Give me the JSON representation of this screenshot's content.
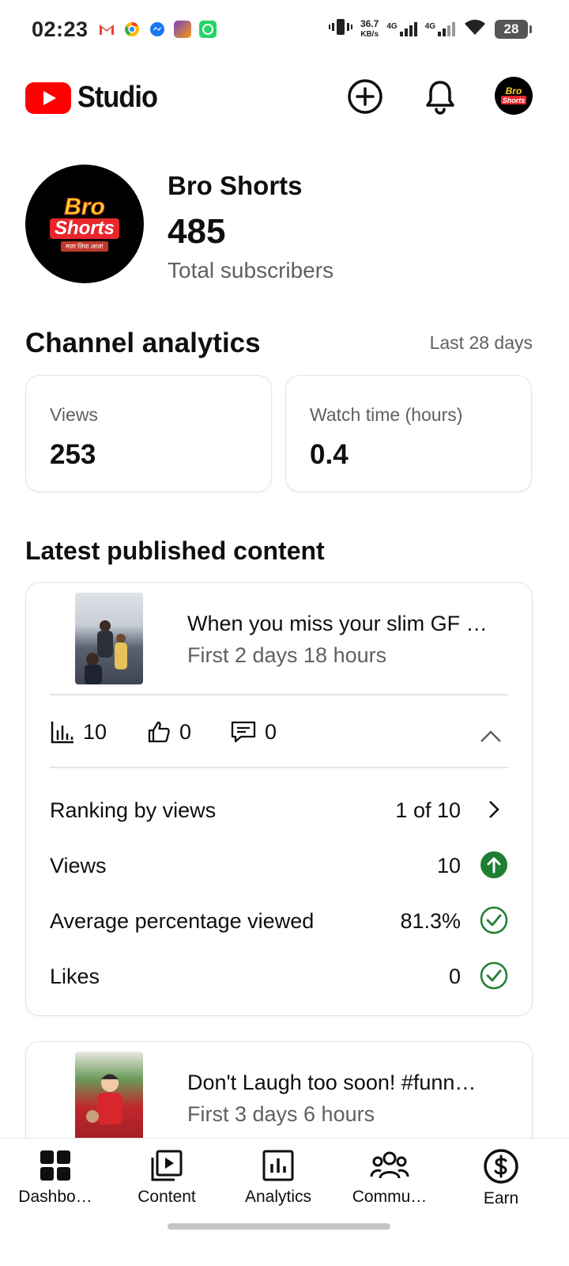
{
  "status_bar": {
    "time": "02:23",
    "net_speed": "36.7",
    "net_speed_unit": "KB/s",
    "signal_1": "4G",
    "signal_2": "4G",
    "battery": "28"
  },
  "app_bar": {
    "logo_text": "Studio",
    "create_icon": "plus-circle-icon",
    "notifications_icon": "bell-icon"
  },
  "channel": {
    "name": "Bro Shorts",
    "subscribers": "485",
    "subscribers_label": "Total subscribers",
    "avatar_text_1": "Bro",
    "avatar_text_2": "Shorts",
    "avatar_tagline": "मज़ा लिया आज!"
  },
  "analytics": {
    "title": "Channel analytics",
    "range": "Last 28 days",
    "cards": [
      {
        "label": "Views",
        "value": "253"
      },
      {
        "label": "Watch time (hours)",
        "value": "0.4"
      }
    ]
  },
  "latest": {
    "title": "Latest published content",
    "items": [
      {
        "title": "When you miss your slim GF …",
        "meta": "First 2 days 18 hours",
        "views": "10",
        "likes": "0",
        "comments": "0",
        "rows": [
          {
            "label": "Ranking by views",
            "value": "1 of 10",
            "icon": "chevron-right-icon"
          },
          {
            "label": "Views",
            "value": "10",
            "icon": "arrow-up-circle-icon"
          },
          {
            "label": "Average percentage viewed",
            "value": "81.3%",
            "icon": "check-circle-icon"
          },
          {
            "label": "Likes",
            "value": "0",
            "icon": "check-circle-icon"
          }
        ]
      },
      {
        "title": "Don't Laugh too soon! #funn…",
        "meta": "First 3 days 6 hours"
      }
    ]
  },
  "colors": {
    "brand_red": "#ff0000",
    "positive_green": "#1e7f34",
    "secondary_text": "#606060"
  },
  "bottom_nav": [
    {
      "label": "Dashbo…",
      "icon": "dashboard-icon"
    },
    {
      "label": "Content",
      "icon": "content-icon"
    },
    {
      "label": "Analytics",
      "icon": "analytics-icon"
    },
    {
      "label": "Commu…",
      "icon": "community-icon"
    },
    {
      "label": "Earn",
      "icon": "dollar-icon"
    }
  ]
}
